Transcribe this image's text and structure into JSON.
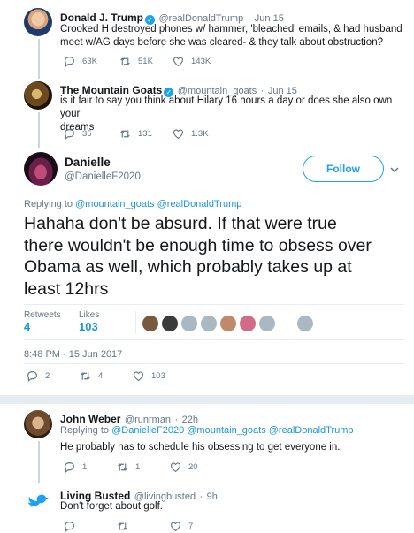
{
  "tweets": [
    {
      "name": "Donald J. Trump",
      "handle": "@realDonaldTrump",
      "date": "Jun 15",
      "line1": "Crooked H destroyed phones w/ hammer, 'bleached' emails, & had husband",
      "line2": "meet w/AG days before she was cleared- & they talk about obstruction?",
      "replies": "63K",
      "retweets": "51K",
      "likes": "143K"
    },
    {
      "name": "The Mountain Goats",
      "handle": "@mountain_goats",
      "date": "Jun 15",
      "line1": "is it fair to say you think about Hilary 16 hours a day or does she also own your",
      "line2": "dreams",
      "replies": "35",
      "retweets": "131",
      "likes": "1.3K"
    }
  ],
  "main": {
    "name": "Danielle",
    "handle": "@DanielleF2020",
    "follow_label": "Follow",
    "replying_prefix": "Replying to",
    "replying_to": "@mountain_goats @realDonaldTrump",
    "body_lines": [
      "Hahaha don't be absurd. If that were true",
      "there wouldn't be enough time to obsess over",
      "Obama as well, which probably takes up at",
      "least 12hrs"
    ],
    "retweets_label": "Retweets",
    "retweets_value": "4",
    "likes_label": "Likes",
    "likes_value": "103",
    "timestamp": "8:48 PM - 15 Jun 2017",
    "replies": "2",
    "retweets": "4",
    "likes": "103"
  },
  "replies": [
    {
      "name": "John Weber",
      "handle": "@runrman",
      "date": "22h",
      "replying_prefix": "Replying to",
      "replying_to": "@DanielleF2020 @mountain_goats @realDonaldTrump",
      "text": "He probably has to schedule his obsessing to get everyone in.",
      "replies": "1",
      "retweets": "1",
      "likes": "20"
    },
    {
      "name": "Living Busted",
      "handle": "@livingbusted",
      "date": "9h",
      "text": "Don't forget about golf.",
      "likes": "7"
    }
  ],
  "colors": {
    "accent": "#1da1f2",
    "link": "#1b95e0",
    "muted": "#657786",
    "divider": "#e6ecf0"
  }
}
